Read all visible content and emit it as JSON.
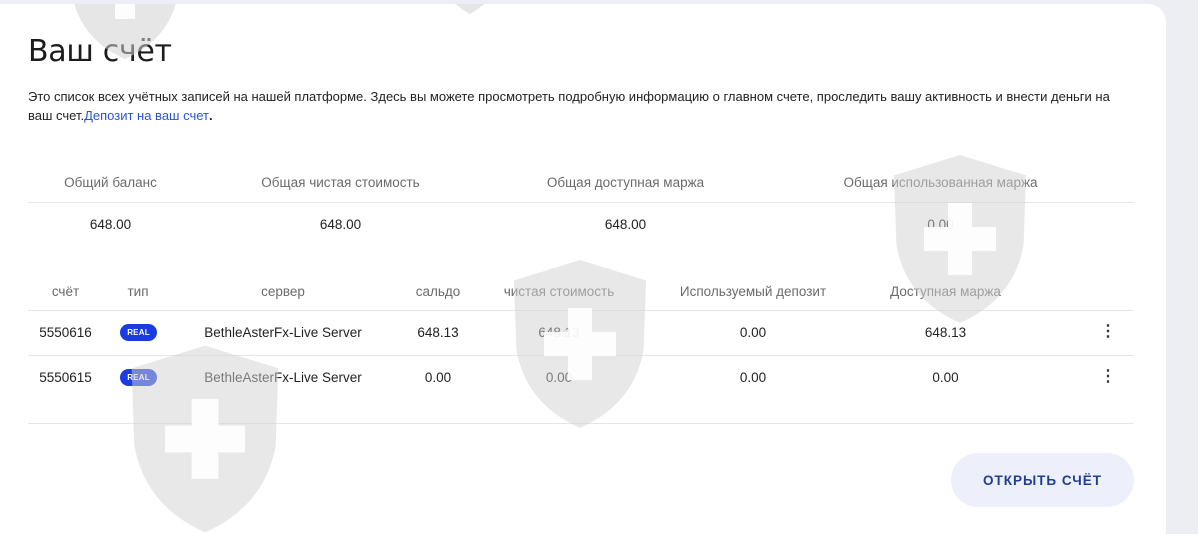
{
  "page": {
    "title": "Ваш счёт",
    "description": "Это список всех учётных записей на нашей платформе. Здесь вы можете просмотреть подробную информацию о главном счете, проследить вашу активность и внести деньги на ваш счет.",
    "deposit_link": "Депозит на ваш счет",
    "dot": "."
  },
  "summary": {
    "headers": [
      "Общий баланс",
      "Общая чистая стоимость",
      "Общая доступная маржа",
      "Общая использованная маржа"
    ],
    "values": [
      "648.00",
      "648.00",
      "648.00",
      "0.00"
    ]
  },
  "accounts": {
    "headers": [
      "счёт",
      "тип",
      "сервер",
      "сальдо",
      "чистая стоимость",
      "Используемый депозит",
      "Доступная маржа"
    ],
    "rows": [
      {
        "account": "5550616",
        "type": "REAL",
        "server": "BethleAsterFx-Live Server",
        "balance": "648.13",
        "equity": "648.13",
        "used_deposit": "0.00",
        "free_margin": "648.13",
        "menu": "⋮"
      },
      {
        "account": "5550615",
        "type": "REAL",
        "server": "BethleAsterFx-Live Server",
        "balance": "0.00",
        "equity": "0.00",
        "used_deposit": "0.00",
        "free_margin": "0.00",
        "menu": "⋮"
      }
    ]
  },
  "actions": {
    "open_account": "ОТКРЫТЬ СЧЁТ"
  },
  "colors": {
    "accent": "#1a3be0",
    "link": "#2b53d6",
    "button_bg": "#edf0fb",
    "button_text": "#1f3f95"
  },
  "icons": {
    "row_menu": "kebab-menu-icon",
    "watermark": "shield-cross-watermark"
  }
}
